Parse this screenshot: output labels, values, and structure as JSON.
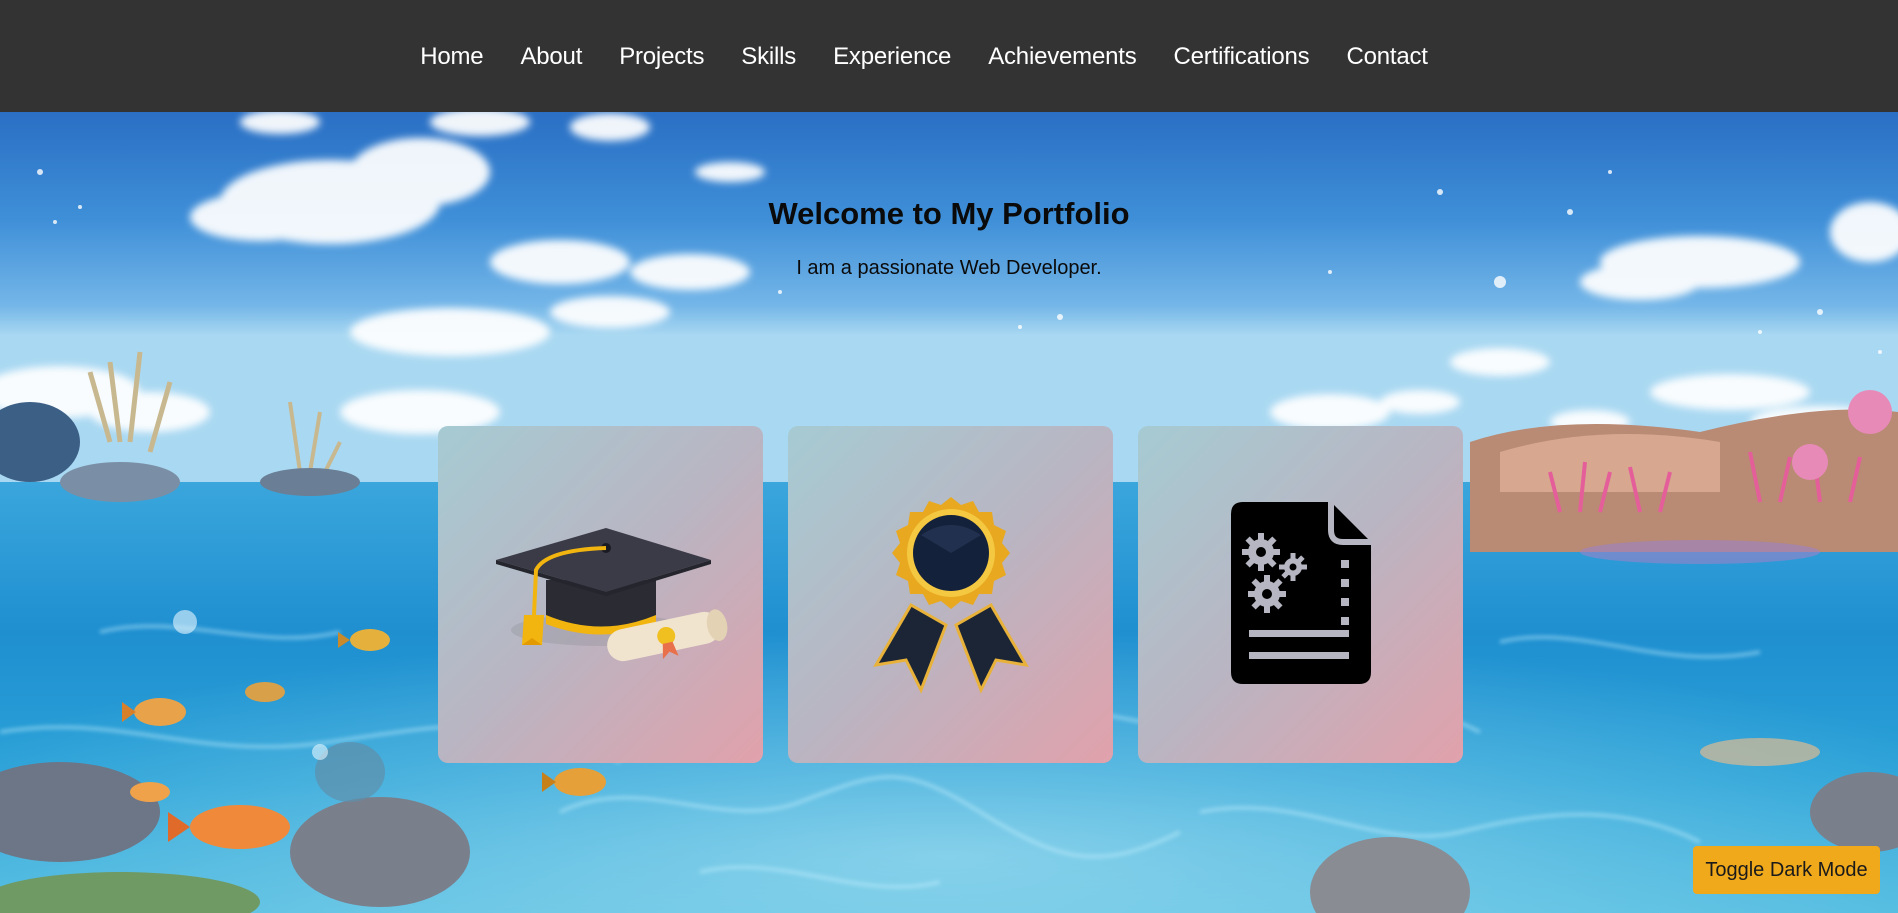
{
  "nav": {
    "items": [
      {
        "label": "Home"
      },
      {
        "label": "About"
      },
      {
        "label": "Projects"
      },
      {
        "label": "Skills"
      },
      {
        "label": "Experience"
      },
      {
        "label": "Achievements"
      },
      {
        "label": "Certifications"
      },
      {
        "label": "Contact"
      }
    ]
  },
  "hero": {
    "title": "Welcome to My Portfolio",
    "subtitle": "I am a passionate Web Developer."
  },
  "cards": [
    {
      "icon": "graduation-cap-icon"
    },
    {
      "icon": "award-ribbon-icon"
    },
    {
      "icon": "document-settings-icon"
    }
  ],
  "toggle": {
    "label": "Toggle Dark Mode"
  },
  "colors": {
    "navbar": "#333333",
    "nav_text": "#ffffff",
    "toggle_button": "#f0a91a",
    "card_gradient_start": "#a6cbd3",
    "card_gradient_end": "#e1a1ab"
  }
}
